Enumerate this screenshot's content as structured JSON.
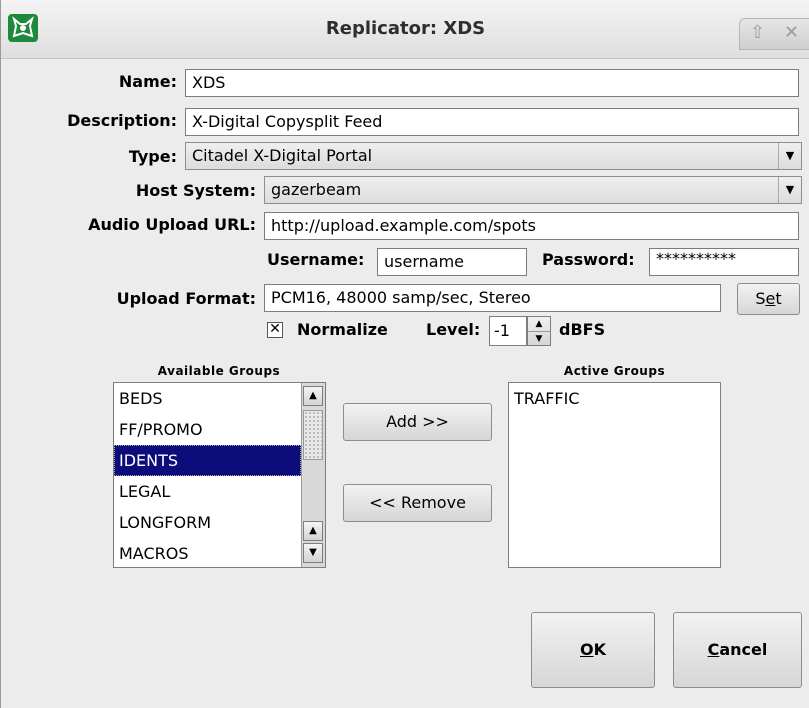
{
  "window": {
    "title": "Replicator: XDS",
    "up_glyph": "⇧",
    "close_glyph": "✕"
  },
  "form": {
    "name_label": "Name:",
    "name_value": "XDS",
    "description_label": "Description:",
    "description_value": "X-Digital Copysplit Feed",
    "type_label": "Type:",
    "type_value": "Citadel X-Digital Portal",
    "host_label": "Host System:",
    "host_value": "gazerbeam",
    "url_label": "Audio Upload URL:",
    "url_value": "http://upload.example.com/spots",
    "username_label": "Username:",
    "username_value": "username",
    "password_label": "Password:",
    "password_value": "**********",
    "format_label": "Upload Format:",
    "format_value": "PCM16, 48000 samp/sec, Stereo",
    "set_button_pre": "S",
    "set_button_ul": "e",
    "set_button_post": "t",
    "normalize_label": "Normalize",
    "normalize_checked": true,
    "level_label": "Level:",
    "level_value": "-1",
    "level_unit": "dBFS"
  },
  "groups": {
    "available_label": "Available Groups",
    "active_label": "Active Groups",
    "available": [
      "BEDS",
      "FF/PROMO",
      "IDENTS",
      "LEGAL",
      "LONGFORM",
      "MACROS"
    ],
    "selected_index": 2,
    "active": [
      "TRAFFIC"
    ],
    "add_label": "Add >>",
    "remove_label": "<< Remove"
  },
  "buttons": {
    "ok_ul": "O",
    "ok_rest": "K",
    "cancel_ul": "C",
    "cancel_rest": "ancel"
  }
}
